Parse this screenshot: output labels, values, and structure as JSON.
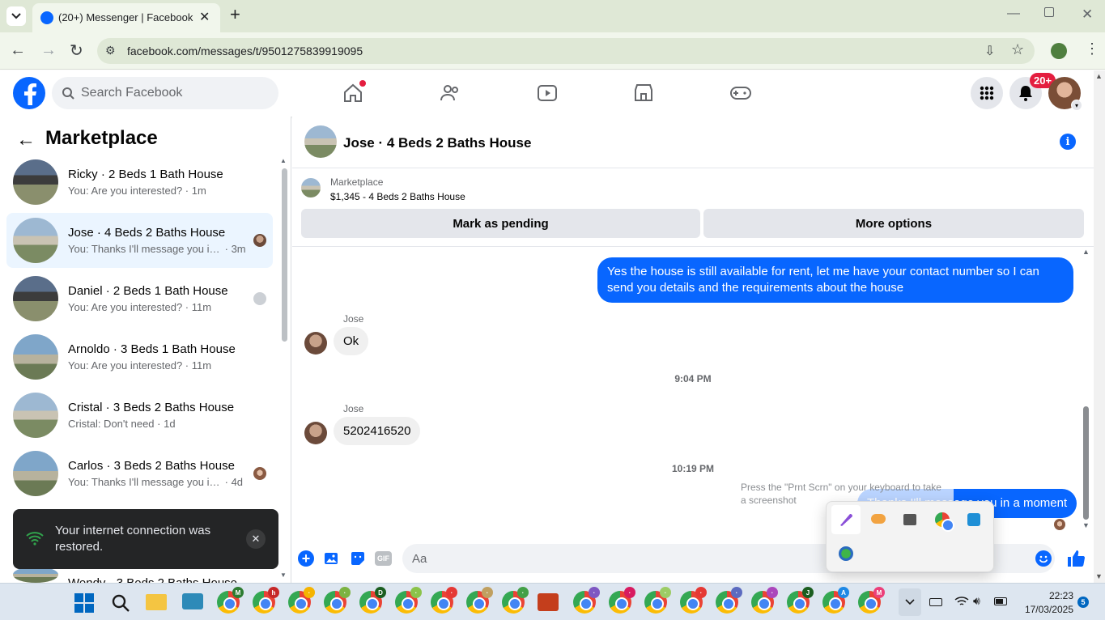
{
  "browser": {
    "tab_title": "(20+) Messenger | Facebook",
    "url": "facebook.com/messages/t/9501275839919095"
  },
  "fb": {
    "search_placeholder": "Search Facebook",
    "notif_badge": "20+"
  },
  "left": {
    "title": "Marketplace",
    "conversations": [
      {
        "name": "Ricky · 2 Beds 1 Bath House",
        "preview": "You: Are you interested?",
        "time": "1m"
      },
      {
        "name": "Jose · 4 Beds 2 Baths House",
        "preview": "You: Thanks I'll message you in ...",
        "time": "3m"
      },
      {
        "name": "Daniel · 2 Beds 1 Bath House",
        "preview": "You: Are you interested?",
        "time": "11m"
      },
      {
        "name": "Arnoldo · 3 Beds 1 Bath House",
        "preview": "You: Are you interested?",
        "time": "11m"
      },
      {
        "name": "Cristal · 3 Beds 2 Baths House",
        "preview": "Cristal: Don't need",
        "time": "1d"
      },
      {
        "name": "Carlos · 3 Beds 2 Baths House",
        "preview": "You: Thanks I'll message you in ...",
        "time": "4d"
      },
      {
        "name": "Wendy · 3 Beds 2 Baths House",
        "preview": "",
        "time": ""
      }
    ],
    "toast": {
      "message": "Your internet connection was restored."
    }
  },
  "chat": {
    "title": "Jose · 4 Beds 2 Baths House",
    "listing_source": "Marketplace",
    "listing": "$1,345 - 4 Beds 2 Baths House",
    "mark_pending": "Mark as pending",
    "more_options": "More options",
    "messages": {
      "m1": "Yes the house is still available for rent, let me have your contact number so I can send you details and the requirements about the house",
      "sender1": "Jose",
      "m2": "Ok",
      "time1": "9:04 PM",
      "sender2": "Jose",
      "m3": "5202416520",
      "time2": "10:19 PM",
      "m4": "Thanks I'll message you in a moment"
    },
    "input_placeholder": "Aa",
    "tooltip": "Press the \"Prnt Scrn\" on your keyboard to take a screenshot"
  },
  "taskbar": {
    "time": "22:23",
    "date": "17/03/2025",
    "notif_count": "5"
  },
  "colors": {
    "fb_blue": "#0866ff",
    "accent_red": "#e41e3f"
  }
}
